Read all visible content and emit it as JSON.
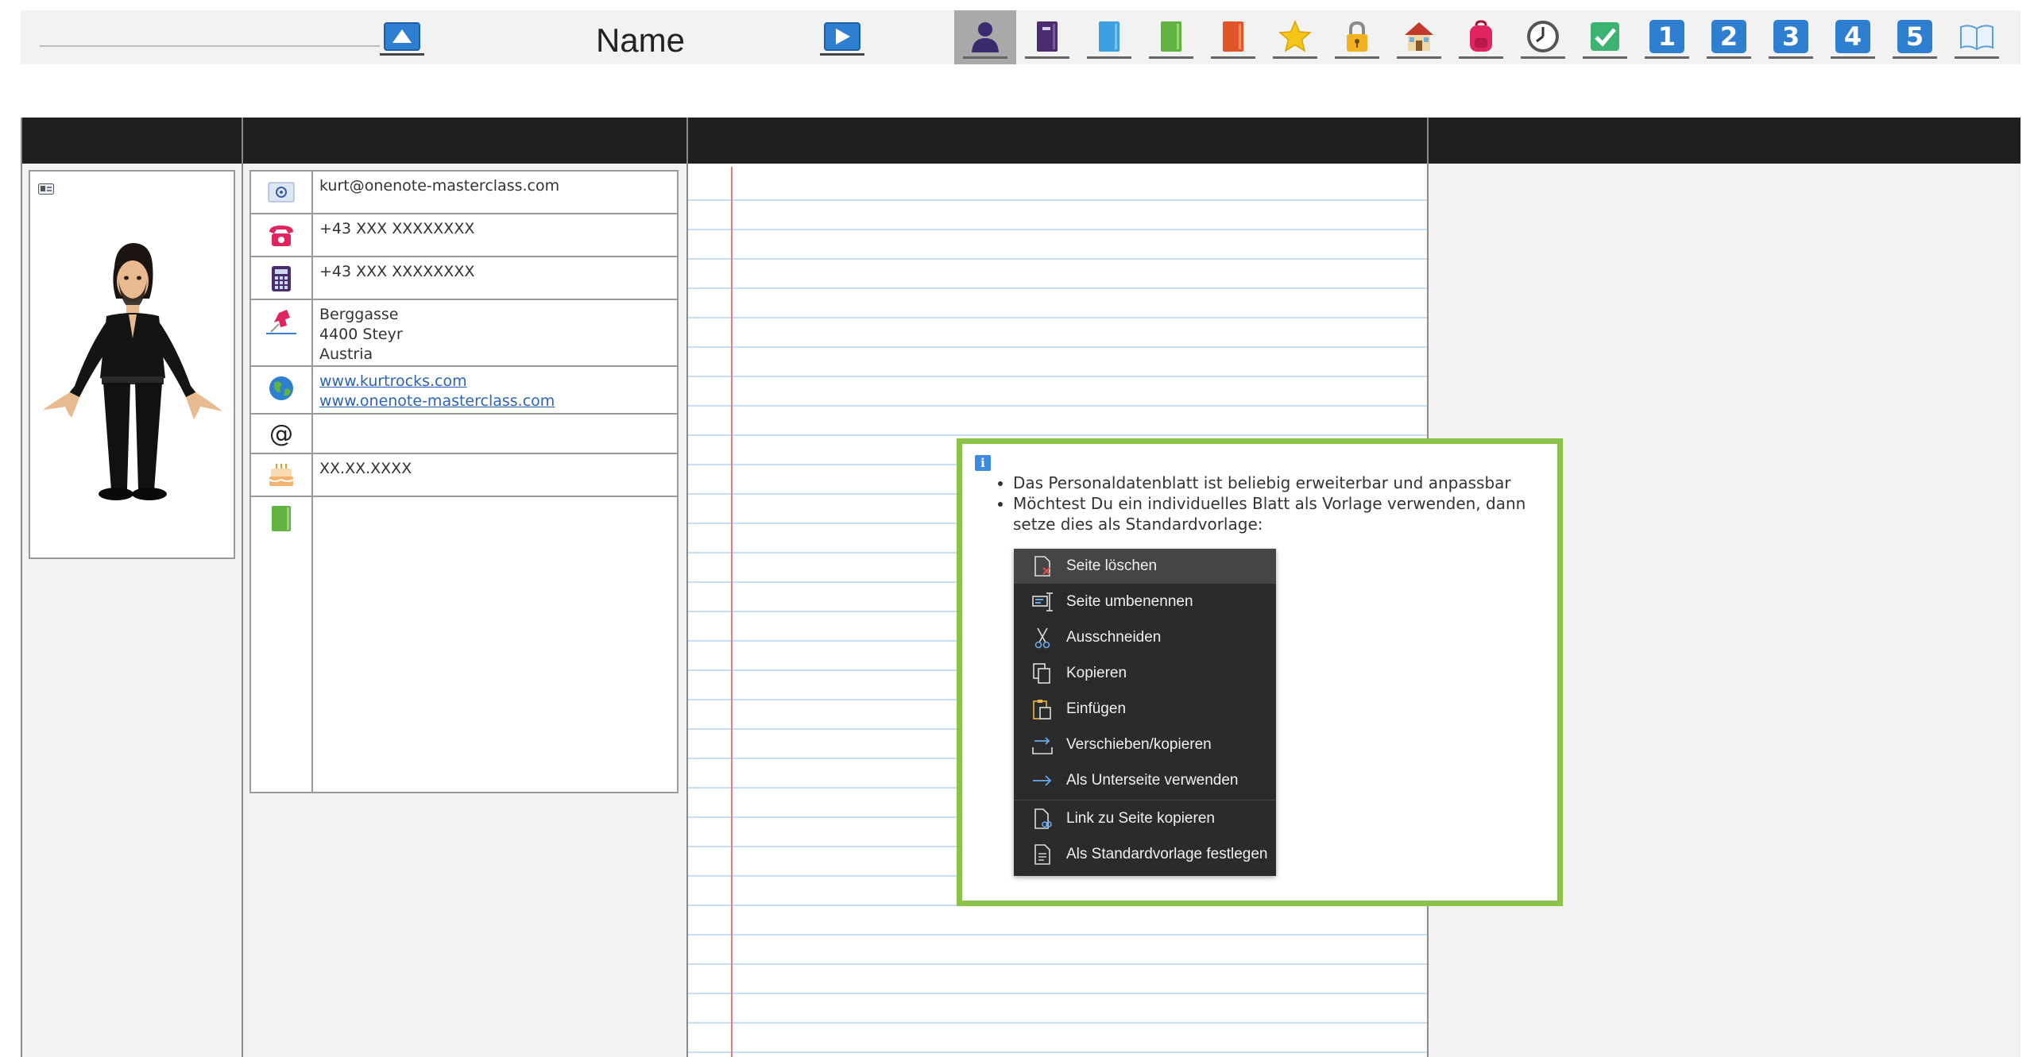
{
  "nav": {
    "title": "Name",
    "prev_icon": "up-arrow-icon",
    "next_icon": "play-arrow-icon"
  },
  "tabs": [
    {
      "icon": "person-icon",
      "active": true
    },
    {
      "icon": "purple-notebook-icon"
    },
    {
      "icon": "blue-notebook-icon"
    },
    {
      "icon": "green-notebook-icon"
    },
    {
      "icon": "orange-notebook-icon"
    },
    {
      "icon": "star-icon"
    },
    {
      "icon": "lock-icon"
    },
    {
      "icon": "house-icon"
    },
    {
      "icon": "backpack-icon"
    },
    {
      "icon": "clock-icon"
    },
    {
      "icon": "checkmark-icon"
    },
    {
      "icon": "number-icon",
      "label": "1"
    },
    {
      "icon": "number-icon",
      "label": "2"
    },
    {
      "icon": "number-icon",
      "label": "3"
    },
    {
      "icon": "number-icon",
      "label": "4"
    },
    {
      "icon": "number-icon",
      "label": "5"
    },
    {
      "icon": "open-book-icon"
    }
  ],
  "contact": {
    "email": "kurt@onenote-masterclass.com",
    "phone": "+43 XXX XXXXXXXX",
    "mobile": "+43 XXX XXXXXXXX",
    "address": [
      "Berggasse",
      "4400 Steyr",
      "Austria"
    ],
    "web": [
      "www.kurtrocks.com",
      "www.onenote-masterclass.com"
    ],
    "at_symbol": "@",
    "at_value": "",
    "birthday": "XX.XX.XXXX",
    "notes": ""
  },
  "info": {
    "bullets": [
      "Das Personaldatenblatt ist beliebig erweiterbar und anpassbar",
      "Möchtest Du ein individuelles Blatt als Vorlage verwenden, dann setze dies als Standardvorlage:"
    ]
  },
  "context_menu": [
    {
      "label": "Seite löschen",
      "icon": "delete-page-icon",
      "hover": true
    },
    {
      "label": "Seite umbenennen",
      "icon": "rename-page-icon"
    },
    {
      "label": "Ausschneiden",
      "icon": "scissors-icon"
    },
    {
      "label": "Kopieren",
      "icon": "copy-icon"
    },
    {
      "label": "Einfügen",
      "icon": "paste-icon"
    },
    {
      "label": "Verschieben/kopieren",
      "icon": "move-copy-icon"
    },
    {
      "label": "Als Unterseite verwenden",
      "icon": "subpage-arrow-icon"
    },
    {
      "label": "Link zu Seite kopieren",
      "icon": "link-page-icon",
      "separator_before": true
    },
    {
      "label": "Als Standardvorlage festlegen",
      "icon": "template-icon"
    }
  ],
  "colors": {
    "accent_blue": "#2f7fd1",
    "callout_green": "#8bc34a",
    "header_black": "#1f1f1f",
    "menu_bg": "#2b2b2b",
    "margin_red": "#e57b7b"
  }
}
